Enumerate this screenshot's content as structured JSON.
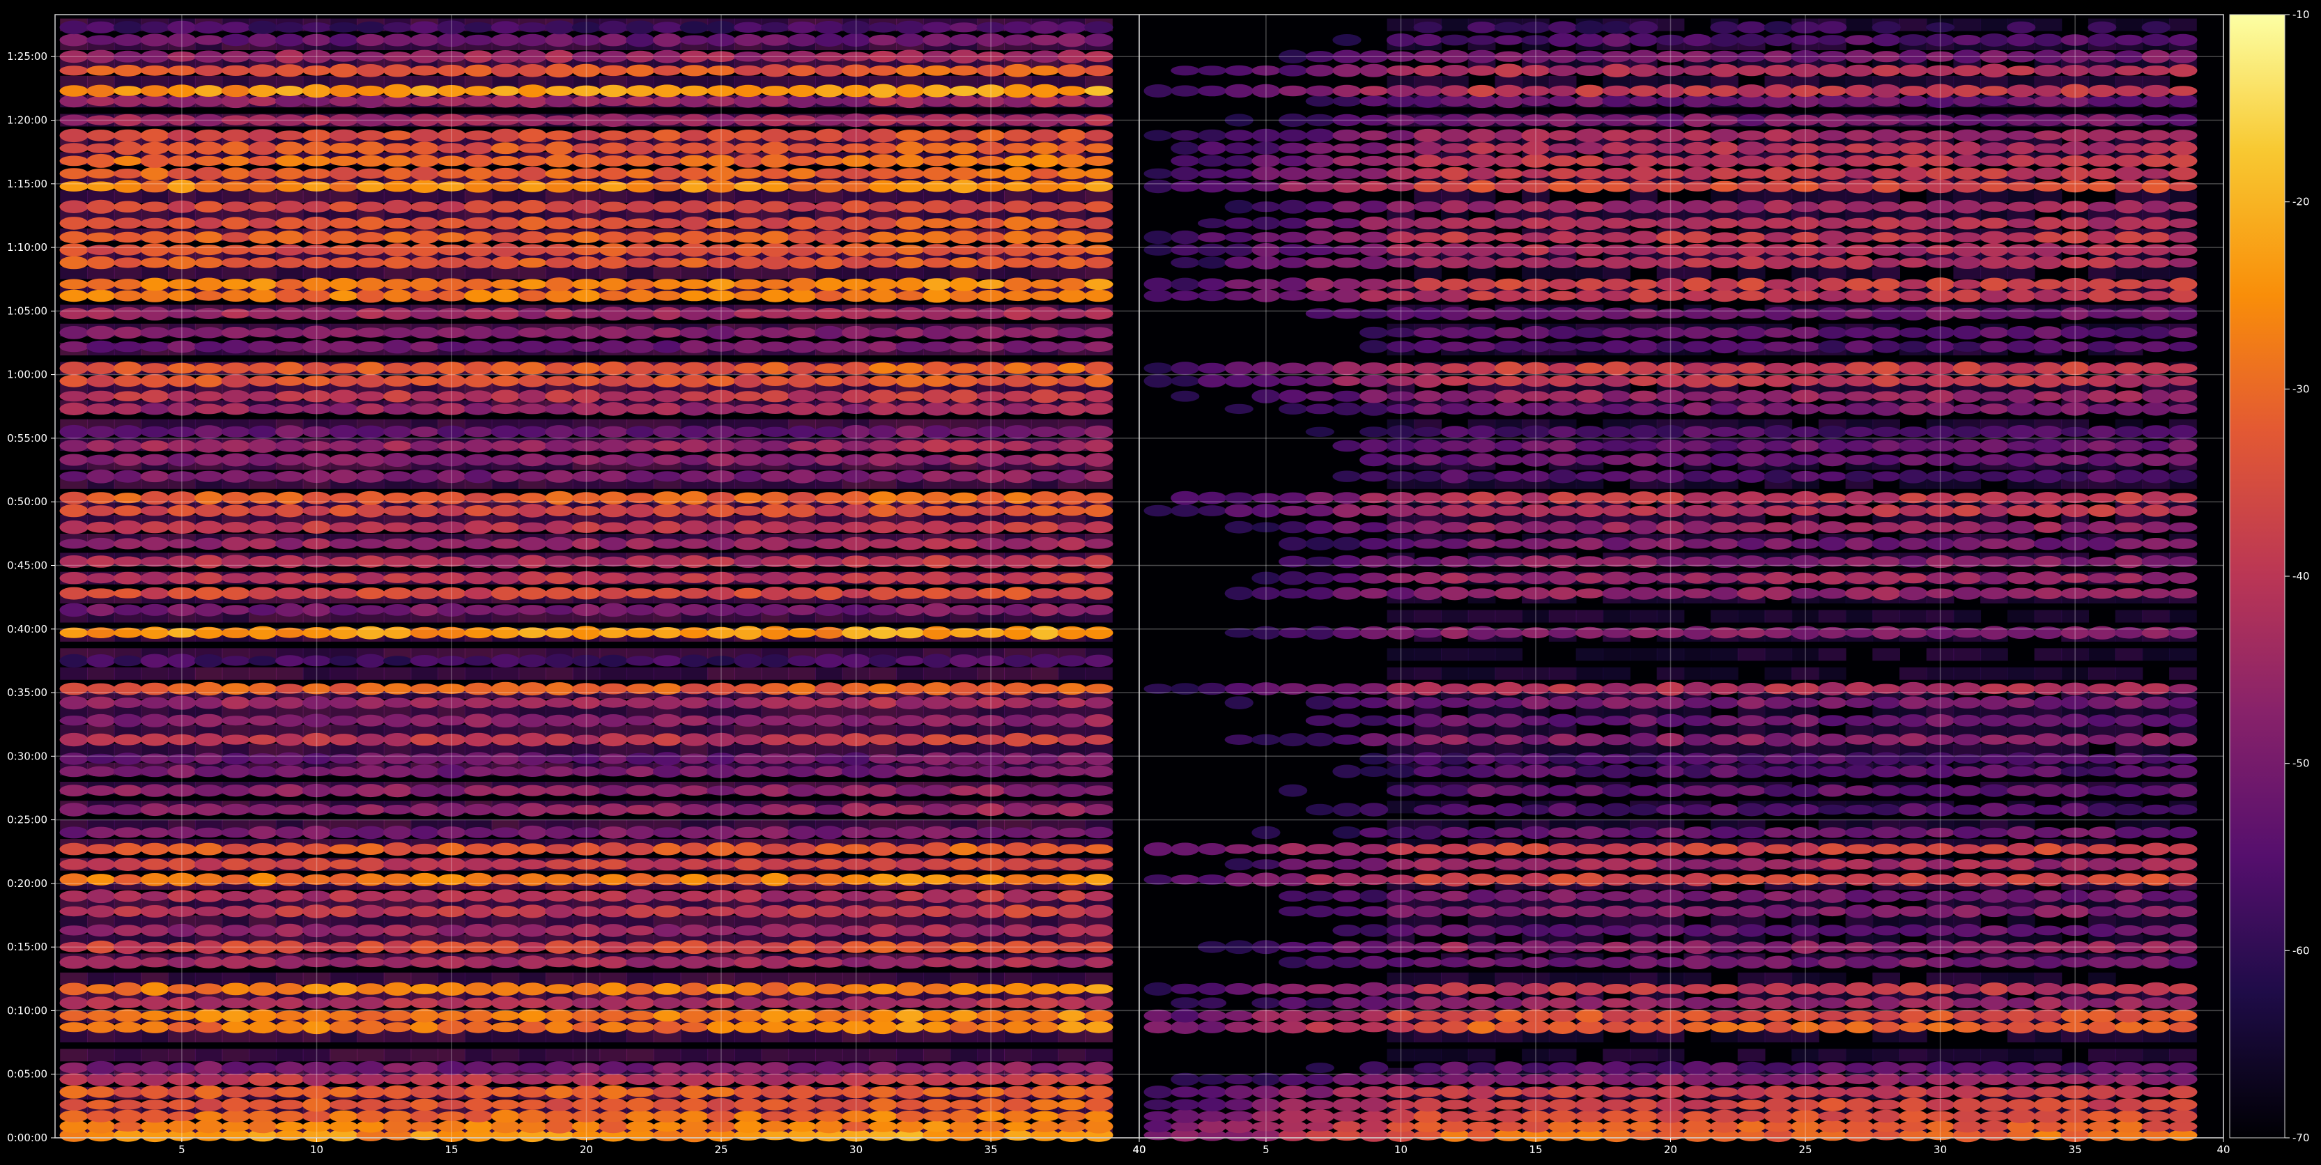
{
  "chart_data": {
    "type": "heatmap",
    "title": "",
    "colormap": "inferno",
    "background": "#000000",
    "grid": true,
    "colorbar": {
      "ticks": [
        "-10",
        "-20",
        "-30",
        "-40",
        "-50",
        "-60",
        "-70"
      ],
      "range": [
        -70,
        -10
      ]
    },
    "y_ticks": [
      "0:00:00",
      "0:05:00",
      "0:10:00",
      "0:15:00",
      "0:20:00",
      "0:25:00",
      "0:30:00",
      "0:35:00",
      "0:40:00",
      "0:45:00",
      "0:50:00",
      "0:55:00",
      "1:00:00",
      "1:05:00",
      "1:10:00",
      "1:15:00",
      "1:20:00",
      "1:25:00"
    ],
    "y_range_minutes": [
      0,
      88.3
    ],
    "panels": [
      {
        "name": "left",
        "x_ticks": [
          "5",
          "10",
          "15",
          "20",
          "25",
          "30",
          "35",
          "40"
        ],
        "x_range": [
          1,
          40
        ],
        "bands": [
          {
            "t": 0.2,
            "level": -25
          },
          {
            "t": 0.9,
            "level": -28
          },
          {
            "t": 1.7,
            "level": -30
          },
          {
            "t": 2.6,
            "level": -33
          },
          {
            "t": 3.6,
            "level": -32
          },
          {
            "t": 4.6,
            "level": -40
          },
          {
            "t": 5.5,
            "level": -50
          },
          {
            "t": 8.7,
            "level": -28
          },
          {
            "t": 9.6,
            "level": -27
          },
          {
            "t": 10.6,
            "level": -42
          },
          {
            "t": 11.7,
            "level": -27
          },
          {
            "t": 13.8,
            "level": -44
          },
          {
            "t": 15.0,
            "level": -36
          },
          {
            "t": 16.3,
            "level": -45
          },
          {
            "t": 17.8,
            "level": -40
          },
          {
            "t": 19.0,
            "level": -42
          },
          {
            "t": 20.3,
            "level": -28
          },
          {
            "t": 21.5,
            "level": -38
          },
          {
            "t": 22.7,
            "level": -33
          },
          {
            "t": 24.0,
            "level": -50
          },
          {
            "t": 25.8,
            "level": -47
          },
          {
            "t": 27.3,
            "level": -48
          },
          {
            "t": 28.8,
            "level": -50
          },
          {
            "t": 29.8,
            "level": -52
          },
          {
            "t": 31.3,
            "level": -40
          },
          {
            "t": 32.8,
            "level": -48
          },
          {
            "t": 34.2,
            "level": -45
          },
          {
            "t": 35.3,
            "level": -32
          },
          {
            "t": 37.5,
            "level": -58
          },
          {
            "t": 39.7,
            "level": -24
          },
          {
            "t": 41.5,
            "level": -50
          },
          {
            "t": 42.8,
            "level": -36
          },
          {
            "t": 44.0,
            "level": -40
          },
          {
            "t": 45.3,
            "level": -42
          },
          {
            "t": 46.7,
            "level": -45
          },
          {
            "t": 48.0,
            "level": -40
          },
          {
            "t": 49.3,
            "level": -36
          },
          {
            "t": 50.3,
            "level": -32
          },
          {
            "t": 52.0,
            "level": -50
          },
          {
            "t": 53.3,
            "level": -48
          },
          {
            "t": 54.4,
            "level": -45
          },
          {
            "t": 55.5,
            "level": -52
          },
          {
            "t": 57.3,
            "level": -45
          },
          {
            "t": 58.3,
            "level": -40
          },
          {
            "t": 59.5,
            "level": -34
          },
          {
            "t": 60.5,
            "level": -32
          },
          {
            "t": 62.2,
            "level": -52
          },
          {
            "t": 63.3,
            "level": -48
          },
          {
            "t": 64.8,
            "level": -44
          },
          {
            "t": 66.2,
            "level": -28
          },
          {
            "t": 67.1,
            "level": -27
          },
          {
            "t": 68.8,
            "level": -33
          },
          {
            "t": 69.8,
            "level": -34
          },
          {
            "t": 70.8,
            "level": -32
          },
          {
            "t": 71.9,
            "level": -34
          },
          {
            "t": 73.2,
            "level": -36
          },
          {
            "t": 74.8,
            "level": -26
          },
          {
            "t": 75.8,
            "level": -32
          },
          {
            "t": 76.8,
            "level": -30
          },
          {
            "t": 77.8,
            "level": -33
          },
          {
            "t": 78.8,
            "level": -35
          },
          {
            "t": 80.0,
            "level": -44
          },
          {
            "t": 81.5,
            "level": -46
          },
          {
            "t": 82.3,
            "level": -24
          },
          {
            "t": 83.9,
            "level": -33
          },
          {
            "t": 85.0,
            "level": -45
          },
          {
            "t": 86.3,
            "level": -52
          },
          {
            "t": 87.3,
            "level": -58
          }
        ]
      },
      {
        "name": "right",
        "x_ticks": [
          "40",
          "5",
          "10",
          "15",
          "20",
          "25",
          "30",
          "35",
          "40"
        ],
        "x_range": [
          1,
          40
        ],
        "bands": [
          {
            "t": 0.2,
            "level": -30
          },
          {
            "t": 0.9,
            "level": -32
          },
          {
            "t": 1.7,
            "level": -34
          },
          {
            "t": 2.6,
            "level": -36
          },
          {
            "t": 3.6,
            "level": -38
          },
          {
            "t": 4.6,
            "level": -46
          },
          {
            "t": 5.5,
            "level": -55
          },
          {
            "t": 8.7,
            "level": -32
          },
          {
            "t": 9.6,
            "level": -34
          },
          {
            "t": 10.6,
            "level": -46
          },
          {
            "t": 11.7,
            "level": -40
          },
          {
            "t": 13.8,
            "level": -50
          },
          {
            "t": 15.0,
            "level": -46
          },
          {
            "t": 16.3,
            "level": -52
          },
          {
            "t": 17.8,
            "level": -48
          },
          {
            "t": 19.0,
            "level": -50
          },
          {
            "t": 20.3,
            "level": -36
          },
          {
            "t": 21.5,
            "level": -44
          },
          {
            "t": 22.7,
            "level": -36
          },
          {
            "t": 24.0,
            "level": -52
          },
          {
            "t": 25.8,
            "level": -56
          },
          {
            "t": 27.3,
            "level": -54
          },
          {
            "t": 28.8,
            "level": -55
          },
          {
            "t": 29.8,
            "level": -56
          },
          {
            "t": 31.3,
            "level": -48
          },
          {
            "t": 32.8,
            "level": -52
          },
          {
            "t": 34.2,
            "level": -50
          },
          {
            "t": 35.3,
            "level": -42
          },
          {
            "t": 39.7,
            "level": -48
          },
          {
            "t": 42.8,
            "level": -46
          },
          {
            "t": 44.0,
            "level": -45
          },
          {
            "t": 45.3,
            "level": -48
          },
          {
            "t": 46.7,
            "level": -50
          },
          {
            "t": 48.0,
            "level": -46
          },
          {
            "t": 49.3,
            "level": -40
          },
          {
            "t": 50.3,
            "level": -40
          },
          {
            "t": 52.0,
            "level": -56
          },
          {
            "t": 53.3,
            "level": -52
          },
          {
            "t": 54.4,
            "level": -52
          },
          {
            "t": 55.5,
            "level": -56
          },
          {
            "t": 57.3,
            "level": -50
          },
          {
            "t": 58.3,
            "level": -46
          },
          {
            "t": 59.5,
            "level": -40
          },
          {
            "t": 60.5,
            "level": -38
          },
          {
            "t": 62.2,
            "level": -56
          },
          {
            "t": 63.3,
            "level": -54
          },
          {
            "t": 64.8,
            "level": -50
          },
          {
            "t": 66.2,
            "level": -40
          },
          {
            "t": 67.1,
            "level": -38
          },
          {
            "t": 68.8,
            "level": -42
          },
          {
            "t": 69.8,
            "level": -42
          },
          {
            "t": 70.8,
            "level": -40
          },
          {
            "t": 71.9,
            "level": -42
          },
          {
            "t": 73.2,
            "level": -44
          },
          {
            "t": 74.8,
            "level": -36
          },
          {
            "t": 75.8,
            "level": -40
          },
          {
            "t": 76.8,
            "level": -40
          },
          {
            "t": 77.8,
            "level": -42
          },
          {
            "t": 78.8,
            "level": -44
          },
          {
            "t": 80.0,
            "level": -50
          },
          {
            "t": 81.5,
            "level": -52
          },
          {
            "t": 82.3,
            "level": -40
          },
          {
            "t": 83.9,
            "level": -42
          },
          {
            "t": 85.0,
            "level": -50
          },
          {
            "t": 86.3,
            "level": -55
          },
          {
            "t": 87.3,
            "level": -60
          }
        ]
      }
    ]
  }
}
